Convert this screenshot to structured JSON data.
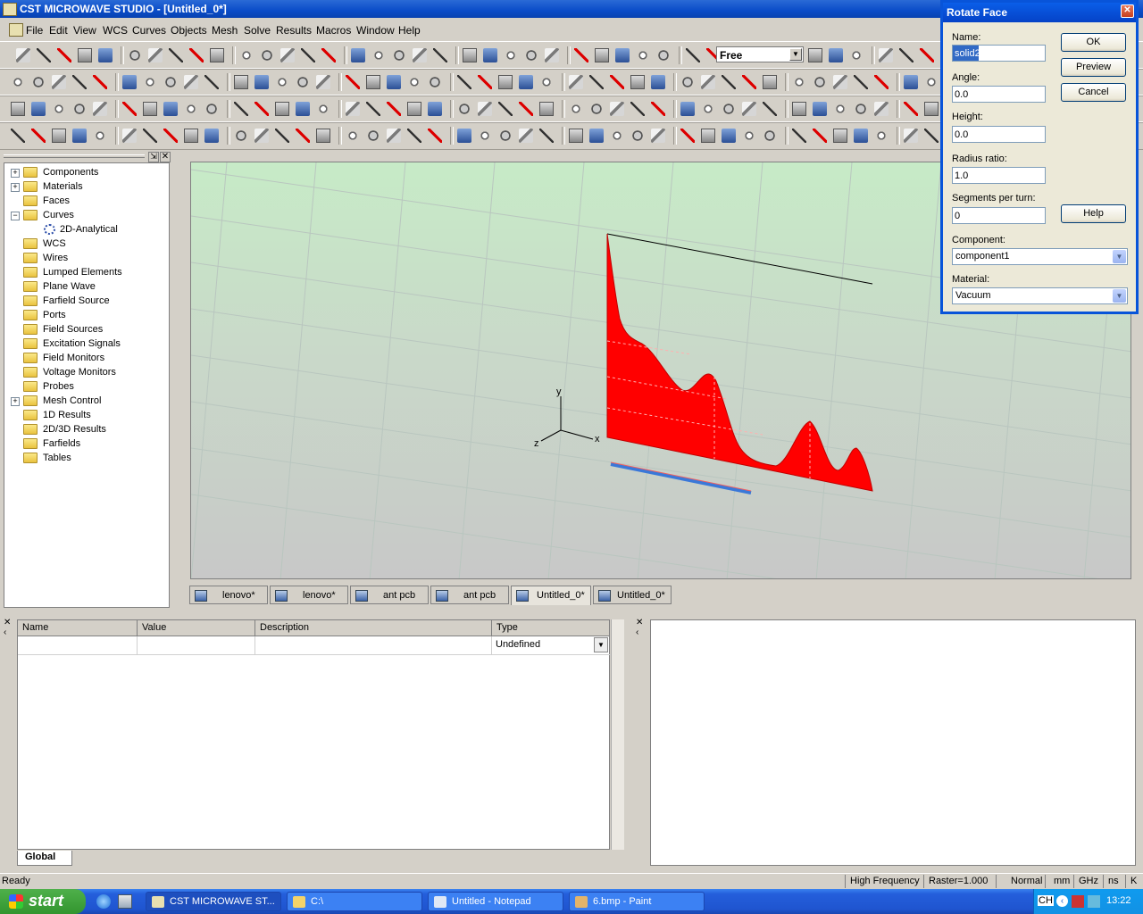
{
  "window": {
    "title": "CST MICROWAVE STUDIO - [Untitled_0*]"
  },
  "menu": [
    "File",
    "Edit",
    "View",
    "WCS",
    "Curves",
    "Objects",
    "Mesh",
    "Solve",
    "Results",
    "Macros",
    "Window",
    "Help"
  ],
  "toolbar": {
    "view_mode": "Free"
  },
  "tree": {
    "items": [
      {
        "label": "Components",
        "expand": "+",
        "level": 0
      },
      {
        "label": "Materials",
        "expand": "+",
        "level": 0
      },
      {
        "label": "Faces",
        "expand": "",
        "level": 0
      },
      {
        "label": "Curves",
        "expand": "-",
        "level": 0
      },
      {
        "label": "2D-Analytical",
        "expand": "",
        "level": 1
      },
      {
        "label": "WCS",
        "expand": "",
        "level": 0
      },
      {
        "label": "Wires",
        "expand": "",
        "level": 0
      },
      {
        "label": "Lumped Elements",
        "expand": "",
        "level": 0
      },
      {
        "label": "Plane Wave",
        "expand": "",
        "level": 0
      },
      {
        "label": "Farfield Source",
        "expand": "",
        "level": 0
      },
      {
        "label": "Ports",
        "expand": "",
        "level": 0
      },
      {
        "label": "Field Sources",
        "expand": "",
        "level": 0
      },
      {
        "label": "Excitation Signals",
        "expand": "",
        "level": 0
      },
      {
        "label": "Field Monitors",
        "expand": "",
        "level": 0
      },
      {
        "label": "Voltage Monitors",
        "expand": "",
        "level": 0
      },
      {
        "label": "Probes",
        "expand": "",
        "level": 0
      },
      {
        "label": "Mesh Control",
        "expand": "+",
        "level": 0
      },
      {
        "label": "1D Results",
        "expand": "",
        "level": 0
      },
      {
        "label": "2D/3D Results",
        "expand": "",
        "level": 0
      },
      {
        "label": "Farfields",
        "expand": "",
        "level": 0
      },
      {
        "label": "Tables",
        "expand": "",
        "level": 0
      }
    ]
  },
  "viewport": {
    "axis_x": "x",
    "axis_y": "y",
    "axis_z": "z",
    "shape_color": "#ff0000",
    "line_color": "#3a78d8"
  },
  "doc_tabs": [
    "lenovo*",
    "lenovo*",
    "ant pcb",
    "ant pcb",
    "Untitled_0*",
    "Untitled_0*"
  ],
  "params": {
    "columns": [
      "Name",
      "Value",
      "Description",
      "Type"
    ],
    "row": {
      "type": "Undefined"
    },
    "tab": "Global"
  },
  "status": {
    "left": "Ready",
    "fields": [
      "High Frequency",
      "Raster=1.000",
      "Normal",
      "mm",
      "GHz",
      "ns",
      "K"
    ]
  },
  "taskbar": {
    "start": "start",
    "tasks": [
      "CST MICROWAVE ST...",
      "C:\\",
      "Untitled - Notepad",
      "6.bmp - Paint"
    ],
    "clock": "13:22",
    "lang": "CH"
  },
  "dialog": {
    "title": "Rotate Face",
    "name_label": "Name:",
    "name_value": "solid2",
    "angle_label": "Angle:",
    "angle_value": "0.0",
    "height_label": "Height:",
    "height_value": "0.0",
    "radius_label": "Radius ratio:",
    "radius_value": "1.0",
    "segments_label": "Segments per turn:",
    "segments_value": "0",
    "component_label": "Component:",
    "component_value": "component1",
    "material_label": "Material:",
    "material_value": "Vacuum",
    "ok": "OK",
    "preview": "Preview",
    "cancel": "Cancel",
    "help": "Help"
  }
}
